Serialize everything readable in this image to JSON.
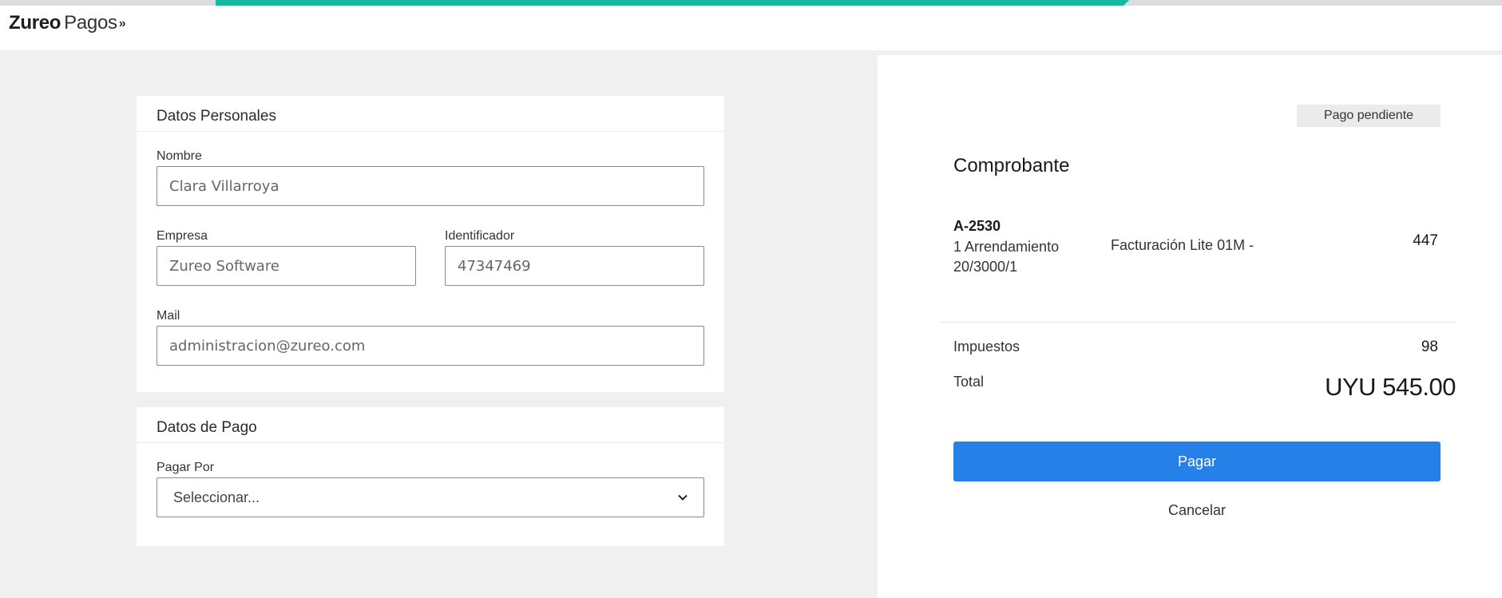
{
  "progress": {
    "fraction": 0.5
  },
  "header": {
    "brand": "Zureo",
    "product": "Pagos",
    "chevron": "»"
  },
  "personal": {
    "title": "Datos Personales",
    "nombre": {
      "label": "Nombre",
      "value": "Clara Villarroya"
    },
    "empresa": {
      "label": "Empresa",
      "value": "Zureo Software"
    },
    "identificador": {
      "label": "Identificador",
      "value": "47347469"
    },
    "mail": {
      "label": "Mail",
      "value": "administracion@zureo.com"
    }
  },
  "payment": {
    "title": "Datos de Pago",
    "pagar_por": {
      "label": "Pagar Por",
      "selected": "Seleccionar..."
    }
  },
  "receipt": {
    "status": "Pago pendiente",
    "title": "Comprobante",
    "item": {
      "code": "A-2530",
      "name": "1 Arrendamiento 20/3000/1",
      "description": "Facturación Lite 01M -",
      "amount": "447"
    },
    "taxes": {
      "label": "Impuestos",
      "amount": "98"
    },
    "total": {
      "label": "Total",
      "amount": "UYU 545.00"
    },
    "pay_label": "Pagar",
    "cancel_label": "Cancelar"
  },
  "colors": {
    "accent": "#19b7a0",
    "primary_button": "#2580e8"
  },
  "icons": {
    "select_arrow": "chevron-down-icon"
  }
}
